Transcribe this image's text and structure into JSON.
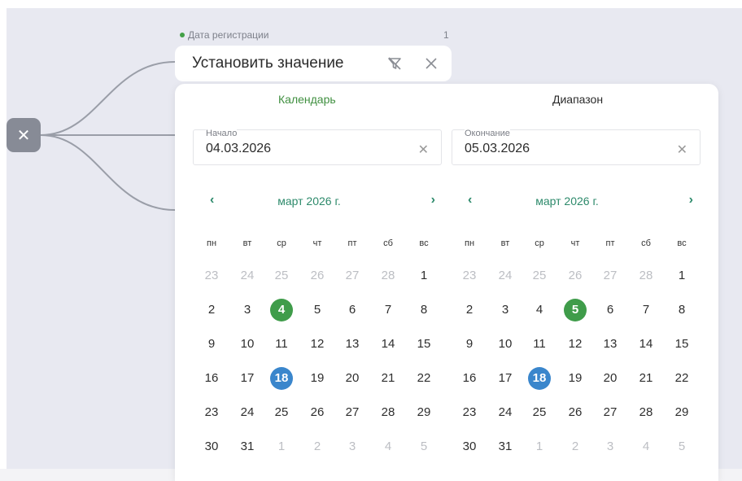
{
  "filter": {
    "field_label": "Дата регистрации",
    "count": "1",
    "value_text": "Установить значение",
    "remove_button_glyph": "✕",
    "icons": {
      "filter": "filter-off-icon",
      "close": "close-icon"
    },
    "colors": {
      "green": "#3f9c4a",
      "teal": "#2d8a6b",
      "blue": "#3a86cc"
    }
  },
  "popup": {
    "tabs": {
      "calendar": "Календарь",
      "range": "Диапазон"
    },
    "start": {
      "label": "Начало",
      "value": "04.03.2026",
      "clear": "✕"
    },
    "end": {
      "label": "Окончание",
      "value": "05.03.2026",
      "clear": "✕"
    }
  },
  "calendars": [
    {
      "month": "март 2026 г.",
      "prev": "‹",
      "next": "›",
      "weekdays": [
        "пн",
        "вт",
        "ср",
        "чт",
        "пт",
        "сб",
        "вс"
      ],
      "weeks": [
        [
          {
            "d": "23",
            "m": true
          },
          {
            "d": "24",
            "m": true
          },
          {
            "d": "25",
            "m": true
          },
          {
            "d": "26",
            "m": true
          },
          {
            "d": "27",
            "m": true
          },
          {
            "d": "28",
            "m": true
          },
          {
            "d": "1"
          }
        ],
        [
          {
            "d": "2"
          },
          {
            "d": "3"
          },
          {
            "d": "4",
            "s": "green"
          },
          {
            "d": "5"
          },
          {
            "d": "6"
          },
          {
            "d": "7"
          },
          {
            "d": "8"
          }
        ],
        [
          {
            "d": "9"
          },
          {
            "d": "10"
          },
          {
            "d": "11"
          },
          {
            "d": "12"
          },
          {
            "d": "13"
          },
          {
            "d": "14"
          },
          {
            "d": "15"
          }
        ],
        [
          {
            "d": "16"
          },
          {
            "d": "17"
          },
          {
            "d": "18",
            "s": "blue"
          },
          {
            "d": "19"
          },
          {
            "d": "20"
          },
          {
            "d": "21"
          },
          {
            "d": "22"
          }
        ],
        [
          {
            "d": "23"
          },
          {
            "d": "24"
          },
          {
            "d": "25"
          },
          {
            "d": "26"
          },
          {
            "d": "27"
          },
          {
            "d": "28"
          },
          {
            "d": "29"
          }
        ],
        [
          {
            "d": "30"
          },
          {
            "d": "31"
          },
          {
            "d": "1",
            "m": true
          },
          {
            "d": "2",
            "m": true
          },
          {
            "d": "3",
            "m": true
          },
          {
            "d": "4",
            "m": true
          },
          {
            "d": "5",
            "m": true
          }
        ]
      ]
    },
    {
      "month": "март 2026 г.",
      "prev": "‹",
      "next": "›",
      "weekdays": [
        "пн",
        "вт",
        "ср",
        "чт",
        "пт",
        "сб",
        "вс"
      ],
      "weeks": [
        [
          {
            "d": "23",
            "m": true
          },
          {
            "d": "24",
            "m": true
          },
          {
            "d": "25",
            "m": true
          },
          {
            "d": "26",
            "m": true
          },
          {
            "d": "27",
            "m": true
          },
          {
            "d": "28",
            "m": true
          },
          {
            "d": "1"
          }
        ],
        [
          {
            "d": "2"
          },
          {
            "d": "3"
          },
          {
            "d": "4"
          },
          {
            "d": "5",
            "s": "green"
          },
          {
            "d": "6"
          },
          {
            "d": "7"
          },
          {
            "d": "8"
          }
        ],
        [
          {
            "d": "9"
          },
          {
            "d": "10"
          },
          {
            "d": "11"
          },
          {
            "d": "12"
          },
          {
            "d": "13"
          },
          {
            "d": "14"
          },
          {
            "d": "15"
          }
        ],
        [
          {
            "d": "16"
          },
          {
            "d": "17"
          },
          {
            "d": "18",
            "s": "blue"
          },
          {
            "d": "19"
          },
          {
            "d": "20"
          },
          {
            "d": "21"
          },
          {
            "d": "22"
          }
        ],
        [
          {
            "d": "23"
          },
          {
            "d": "24"
          },
          {
            "d": "25"
          },
          {
            "d": "26"
          },
          {
            "d": "27"
          },
          {
            "d": "28"
          },
          {
            "d": "29"
          }
        ],
        [
          {
            "d": "30"
          },
          {
            "d": "31"
          },
          {
            "d": "1",
            "m": true
          },
          {
            "d": "2",
            "m": true
          },
          {
            "d": "3",
            "m": true
          },
          {
            "d": "4",
            "m": true
          },
          {
            "d": "5",
            "m": true
          }
        ]
      ]
    }
  ]
}
